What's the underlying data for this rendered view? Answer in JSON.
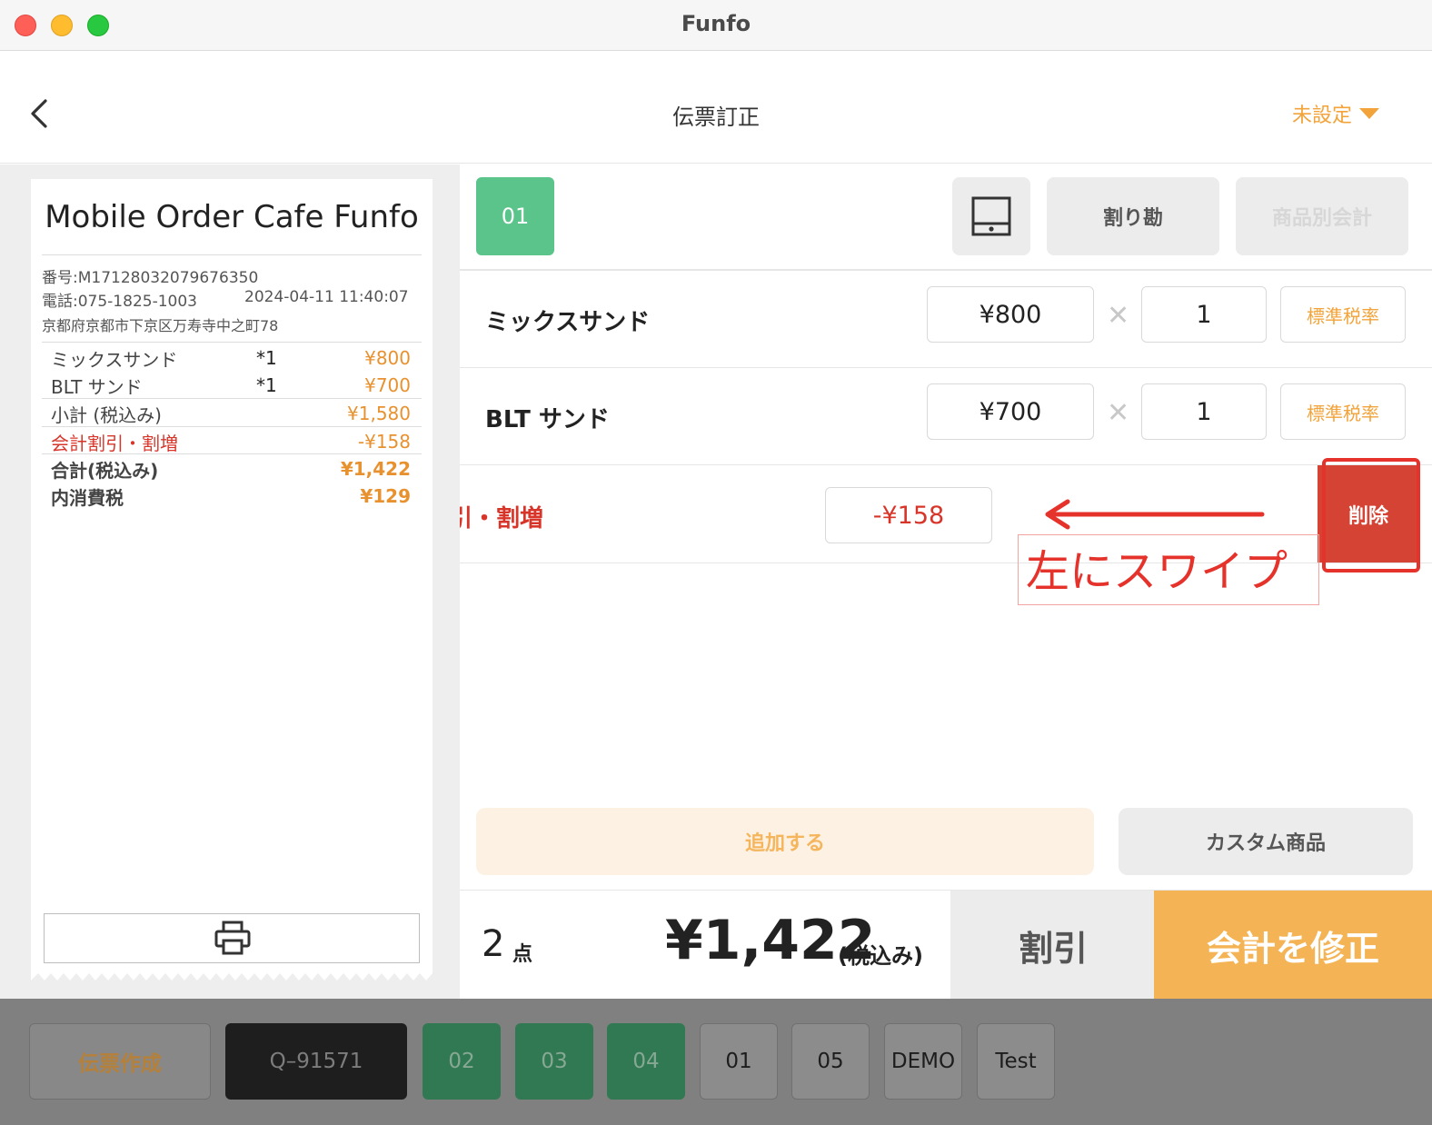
{
  "window": {
    "title": "Funfo"
  },
  "header": {
    "title": "伝票訂正",
    "staff_label": "未設定"
  },
  "receipt": {
    "shop_name": "Mobile Order Cafe Funfo",
    "number": "番号:M17128032079676350",
    "phone": "電話:075-1825-1003",
    "datetime": "2024-04-11 11:40:07",
    "address": "京都府京都市下京区万寿寺中之町78",
    "items": [
      {
        "name": "ミックスサンド",
        "qty": "*1",
        "price": "¥800"
      },
      {
        "name": "BLT サンド",
        "qty": "*1",
        "price": "¥700"
      }
    ],
    "subtotal_label": "小計 (税込み)",
    "subtotal": "¥1,580",
    "discount_label": "会計割引・割増",
    "discount": "-¥158",
    "total_label": "合計(税込み)",
    "total": "¥1,422",
    "tax_label": "内消費税",
    "tax": "¥129"
  },
  "toolbar": {
    "seat": "01",
    "split_label": "割り勘",
    "item_pay_label": "商品別会計"
  },
  "order": {
    "items": [
      {
        "name": "ミックスサンド",
        "price": "¥800",
        "qty": "1",
        "tax": "標準税率"
      },
      {
        "name": "BLT サンド",
        "price": "¥700",
        "qty": "1",
        "tax": "標準税率"
      }
    ],
    "discount": {
      "name": "会計割引・割増",
      "visible_name": "引・割増",
      "price": "-¥158",
      "delete_label": "削除"
    }
  },
  "annotation": {
    "text": "左にスワイプ"
  },
  "actions": {
    "add_label": "追加する",
    "custom_label": "カスタム商品"
  },
  "summary": {
    "count": "2",
    "count_unit": "点",
    "total": "¥1,422",
    "total_note": "(税込み)",
    "discount_label": "割引",
    "submit_label": "会計を修正"
  },
  "tabs": {
    "create": "伝票作成",
    "active": "Q–91571",
    "items": [
      "02",
      "03",
      "04",
      "01",
      "05",
      "DEMO",
      "Test"
    ]
  },
  "colors": {
    "accent": "#f4b455",
    "seat_green": "#5bc48a",
    "danger": "#d44333",
    "annotation": "#e5322b"
  }
}
